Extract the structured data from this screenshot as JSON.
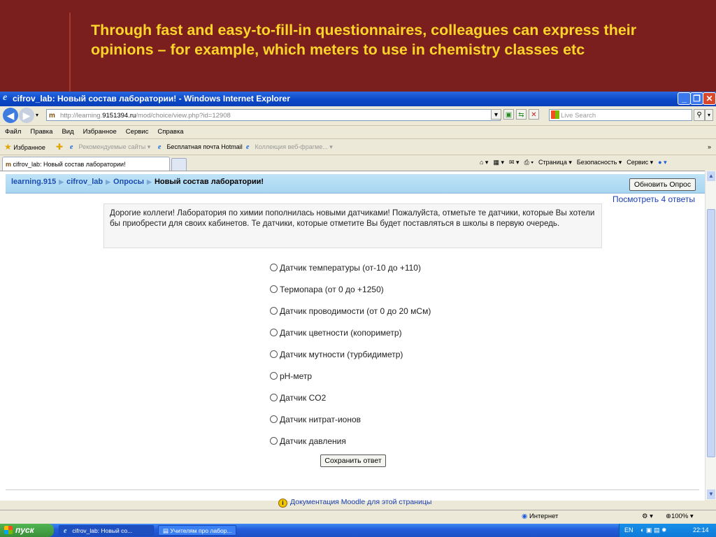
{
  "slide": {
    "title": "Through fast and easy-to-fill-in questionnaires, colleagues can express their opinions – for example, which meters to use in chemistry classes etc"
  },
  "window": {
    "title": "cifrov_lab: Новый состав лаборатории! - Windows Internet Explorer"
  },
  "address": {
    "url_prefix": "http://learning.",
    "url_host": "9151394.ru",
    "url_path": "/mod/choice/view.php?id=12908",
    "search_placeholder": "Live Search"
  },
  "menu": [
    "Файл",
    "Правка",
    "Вид",
    "Избранное",
    "Сервис",
    "Справка"
  ],
  "favorites": {
    "label": "Избранное",
    "items": [
      "Рекомендуемые сайты ▾",
      "Бесплатная почта Hotmail",
      "Коллекция веб-фрагме... ▾"
    ]
  },
  "tab": {
    "label": "cifrov_lab: Новый состав лаборатории!"
  },
  "commands": [
    "Страница ▾",
    "Безопасность ▾",
    "Сервис ▾"
  ],
  "breadcrumb": [
    "learning.915",
    "cifrov_lab",
    "Опросы",
    "Новый состав лаборатории!"
  ],
  "page": {
    "update_button": "Обновить Опрос",
    "view_link": "Посмотреть 4 ответы",
    "intro": "Дорогие коллеги! Лаборатория по химии пополнилась новыми датчиками! Пожалуйста, отметьте те датчики, которые Вы хотели бы приобрести для своих кабинетов. Те датчики, которые отметите Вы будет поставляться в школы в первую очередь.",
    "options": [
      "Датчик температуры (от-10 до +110)",
      "Термопара (от 0 до +1250)",
      "Датчик проводимости (от 0 до 20 мСм)",
      "Датчик цветности (копориметр)",
      "Датчик мутности (турбидиметр)",
      "pH-метр",
      "Датчик CO2",
      "Датчик нитрат-ионов",
      "Датчик давления"
    ],
    "save_button": "Сохранить ответ",
    "doc_link": "Документация Moodle для этой страницы"
  },
  "status": {
    "zone": "Интернет",
    "zoom": "100%"
  },
  "taskbar": {
    "start": "пуск",
    "tasks": [
      "cifrov_lab: Новый со...",
      "Учителям про лабор..."
    ],
    "lang": "EN",
    "time": "22:14"
  }
}
